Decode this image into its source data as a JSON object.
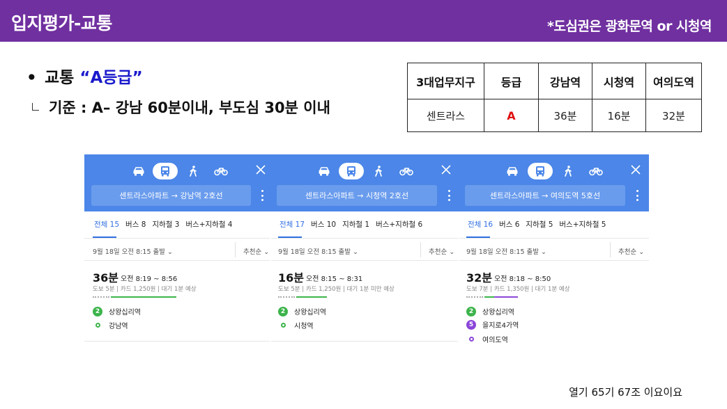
{
  "header": {
    "title": "입지평가-교통",
    "note": "*도심권은 광화문역 or 시청역"
  },
  "bullets": {
    "b1_label": "교통",
    "b1_grade": "“A등급”",
    "b2_text": "기준 : A– 강남 60분이내, 부도심 30분 이내"
  },
  "table": {
    "headers": [
      "3대업무지구",
      "등급",
      "강남역",
      "시청역",
      "여의도역"
    ],
    "row": [
      "센트라스",
      "A",
      "36분",
      "16분",
      "32분"
    ]
  },
  "colors": {
    "header_bg": "#7030a0",
    "map_blue": "#4b86e8",
    "line2_green": "#3cb44b",
    "line5_purple": "#8b46d8",
    "grade_red": "#e01010"
  },
  "panels": [
    {
      "route": "센트라스아파트 → 강남역 2호선",
      "tabs": [
        "전체 15",
        "버스 8",
        "지하철 3",
        "버스+지하철 4"
      ],
      "depart": "9월 18일 오전 8:15 출발 ⌄",
      "sort": "추천순 ⌄",
      "duration": "36분",
      "time": "오전 8:19 ~ 8:56",
      "meta": "도보 5분 | 카드 1,250원 | 대기 1분 예상",
      "stops": [
        {
          "line": "2",
          "name": "상왕십리역"
        },
        {
          "line": "",
          "name": "강남역"
        }
      ]
    },
    {
      "route": "센트라스아파트 → 시청역 2호선",
      "tabs": [
        "전체 17",
        "버스 10",
        "지하철 1",
        "버스+지하철 6"
      ],
      "depart": "9월 18일 오전 8:15 출발 ⌄",
      "sort": "추천순 ⌄",
      "duration": "16분",
      "time": "오전 8:15 ~ 8:31",
      "meta": "도보 5분 | 카드 1,250원 | 대기 1분 미만 예상",
      "stops": [
        {
          "line": "2",
          "name": "상왕십리역"
        },
        {
          "line": "",
          "name": "시청역"
        }
      ]
    },
    {
      "route": "센트라스아파트 → 여의도역 5호선",
      "tabs": [
        "전체 16",
        "버스 6",
        "지하철 5",
        "버스+지하철 5"
      ],
      "depart": "9월 18일 오전 8:15 출발 ⌄",
      "sort": "추천순 ⌄",
      "duration": "32분",
      "time": "오전 8:18 ~ 8:50",
      "meta": "도보 7분 | 카드 1,350원 | 대기 1분 예상",
      "stops": [
        {
          "line": "2",
          "name": "상왕십리역"
        },
        {
          "line": "5",
          "name": "을지로4가역"
        },
        {
          "line": "",
          "name": "여의도역"
        }
      ]
    }
  ],
  "footer": "열기 65기 67조 이요이요"
}
